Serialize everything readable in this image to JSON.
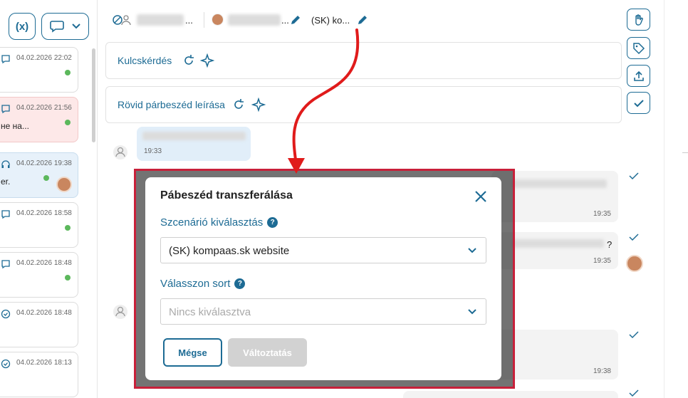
{
  "left": {
    "var_button": "(x)",
    "conversations": [
      {
        "date": "04.02.2026 22:02",
        "snippet": "",
        "icon": "chat-icon",
        "status": "online"
      },
      {
        "date": "04.02.2026 21:56",
        "snippet": "не на...",
        "icon": "chat-icon",
        "status": "online"
      },
      {
        "date": "04.02.2026 19:38",
        "snippet": "er.",
        "icon": "headset-icon",
        "status": "online"
      },
      {
        "date": "04.02.2026 18:58",
        "snippet": "",
        "icon": "chat-icon",
        "status": "online"
      },
      {
        "date": "04.02.2026 18:48",
        "snippet": "",
        "icon": "chat-icon",
        "status": "online"
      },
      {
        "date": "04.02.2026 18:48",
        "snippet": "",
        "icon": "check-circle-icon",
        "status": ""
      },
      {
        "date": "04.02.2026 18:13",
        "snippet": "",
        "icon": "check-circle-icon",
        "status": ""
      }
    ]
  },
  "header": {
    "dots1": "...",
    "dots2": "...",
    "scenario_short": "(SK) ko..."
  },
  "panels": {
    "key_question": "Kulcskérdés",
    "short_description": "Rövid párbeszéd leírása"
  },
  "messages": {
    "m1_time": "19:33",
    "m2_time": "19:35",
    "m3_time": "19:35",
    "m3_q": "?",
    "m4_time": "19:38"
  },
  "modal": {
    "title": "Pábeszéd transzferálása",
    "scenario_label": "Szcenárió kiválasztás",
    "scenario_value": "(SK) kompaas.sk website",
    "queue_label": "Válasszon sort",
    "queue_placeholder": "Nincs kiválasztva",
    "cancel_label": "Mégse",
    "change_label": "Változtatás",
    "help": "?"
  },
  "colors": {
    "accent": "#1d6b94",
    "highlight": "#c8203a",
    "online": "#5cb85c"
  }
}
